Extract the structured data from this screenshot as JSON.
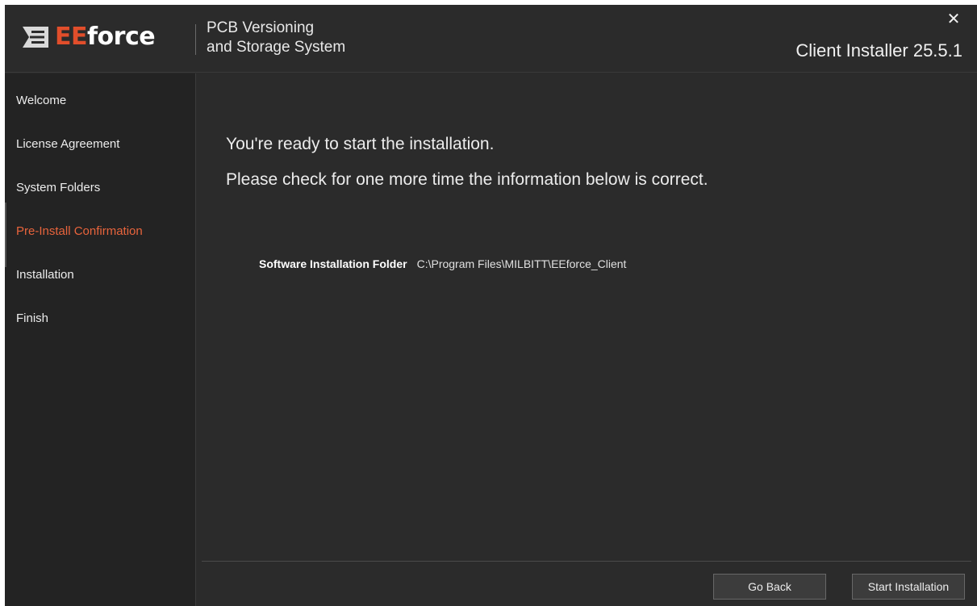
{
  "header": {
    "brand_prefix": "EE",
    "brand_suffix": "force",
    "product_line1": "PCB Versioning",
    "product_line2": "and Storage System",
    "installer_title": "Client Installer 25.5.1",
    "close_glyph": "✕"
  },
  "sidebar": {
    "items": [
      {
        "label": "Welcome"
      },
      {
        "label": "License Agreement"
      },
      {
        "label": "System Folders"
      },
      {
        "label": "Pre-Install Confirmation",
        "active": true
      },
      {
        "label": "Installation"
      },
      {
        "label": "Finish"
      }
    ]
  },
  "main": {
    "heading1": "You're ready to start the installation.",
    "heading2": "Please check for one more time the information below is correct.",
    "install_folder_label": "Software Installation Folder",
    "install_folder_value": "C:\\Program Files\\MILBITT\\EEforce_Client"
  },
  "footer": {
    "back_label": "Go Back",
    "start_label": "Start Installation"
  },
  "colors": {
    "accent": "#e8643c",
    "brand_red": "#e14e2b",
    "background": "#2b2b2b",
    "sidebar_bg": "#232323"
  },
  "icons": {
    "logo": "eeforce-logo-icon",
    "close": "close-icon"
  }
}
